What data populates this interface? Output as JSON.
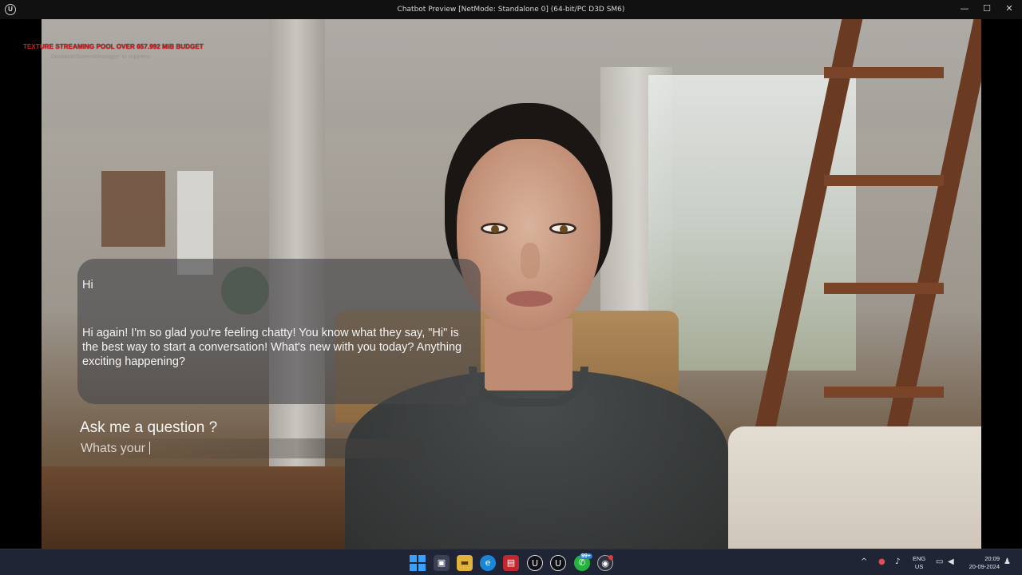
{
  "window": {
    "title": "Chatbot Preview [NetMode: Standalone 0]  (64-bit/PC D3D SM6)",
    "app_icon": "unreal-engine-icon",
    "controls": {
      "minimize": "—",
      "maximize": "☐",
      "close": "✕"
    }
  },
  "debug": {
    "warning": "TEXTURE STREAMING POOL OVER 657.992 MiB BUDGET",
    "hint": "DisableAllScreenMessages' to suppress",
    "warning_color": "#d81b1b"
  },
  "chat": {
    "user_message": "Hi",
    "bot_reply": "Hi again! I'm so glad you're feeling chatty! You know what they say, \"Hi\" is the best way to start a conversation! What's new with you today? Anything exciting happening?"
  },
  "question": {
    "label": "Ask me a question ?",
    "input_value": "Whats your"
  },
  "taskbar": {
    "apps": [
      {
        "name": "start",
        "icon": "windows-start-icon"
      },
      {
        "name": "task-view",
        "icon": "task-view-icon"
      },
      {
        "name": "file-explorer",
        "icon": "folder-icon"
      },
      {
        "name": "edge",
        "icon": "edge-browser-icon"
      },
      {
        "name": "app-hd",
        "icon": "app-icon"
      },
      {
        "name": "unreal-1",
        "icon": "unreal-engine-icon"
      },
      {
        "name": "unreal-2",
        "icon": "unreal-engine-icon"
      },
      {
        "name": "whatsapp",
        "icon": "whatsapp-icon",
        "badge": "99+"
      },
      {
        "name": "app-record",
        "icon": "record-icon"
      }
    ],
    "tray": {
      "language_line1": "ENG",
      "language_line2": "US",
      "time": "20:09",
      "date": "20-09-2024"
    }
  }
}
